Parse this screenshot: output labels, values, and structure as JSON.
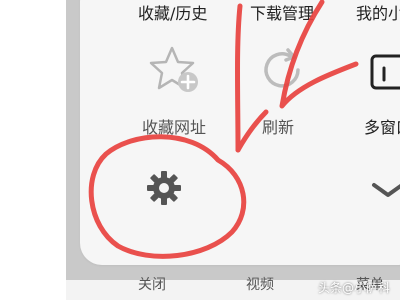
{
  "menu": {
    "top_row": {
      "favorites_history": "收藏/历史",
      "downloads": "下载管理",
      "my_novels": "我的小说"
    },
    "middle_row": {
      "bookmark_site": "收藏网址",
      "refresh": "刷新",
      "multi_window": "多窗口"
    },
    "bottom_row": {
      "settings_icon": "gear-icon",
      "collapse_icon": "chevron-down-icon"
    }
  },
  "tabbar": {
    "close": "关闭",
    "video": "视频",
    "menu": "菜单"
  },
  "watermark": "头条@小萨科",
  "annotation": {
    "color": "#e8423f"
  }
}
